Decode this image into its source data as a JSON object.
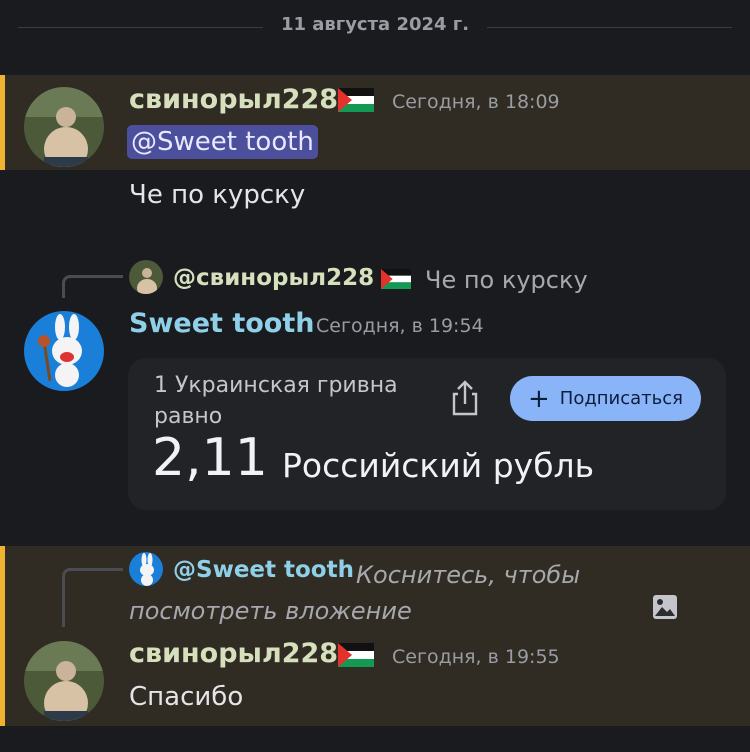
{
  "date_divider": "11 августа 2024 г.",
  "messages": [
    {
      "username": "свинорыл228",
      "timestamp": "Сегодня, в 18:09",
      "mention": "@Sweet tooth",
      "text": "Че по курску"
    },
    {
      "reply": {
        "name": "@свинорыл228",
        "text": "Че по курску"
      },
      "username": "Sweet tooth",
      "timestamp": "Сегодня, в 19:54",
      "embed": {
        "title": "1 Украинская гривна равно",
        "value": "2,11",
        "unit": "Российский рубль",
        "subscribe_label": "Подписаться"
      }
    },
    {
      "reply": {
        "name": "@Sweet tooth",
        "text": "Коснитесь, чтобы посмотреть вложение"
      },
      "username": "свинорыл228",
      "timestamp": "Сегодня, в 19:55",
      "text": "Спасибо"
    }
  ],
  "colors": {
    "background": "#1a1b1f",
    "highlight": "#302b23",
    "highlight_bar": "#f0b232",
    "username_1": "#d6e0bd",
    "username_2": "#8fd0e8",
    "mention": "#4b4f9c",
    "button": "#8ab4f8"
  },
  "icons": [
    "palestine-flag-icon",
    "share-icon",
    "plus-icon",
    "image-icon"
  ]
}
